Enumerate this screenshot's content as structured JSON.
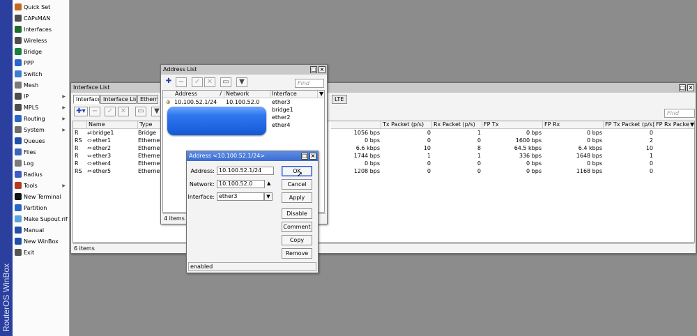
{
  "app": {
    "brand": "RouterOS WinBox"
  },
  "menu": {
    "items": [
      {
        "label": "Quick Set",
        "icon": "quick-set-icon",
        "color": "#c06b1b"
      },
      {
        "label": "CAPsMAN",
        "icon": "capsman-icon",
        "color": "#4d4d4d"
      },
      {
        "label": "Interfaces",
        "icon": "interfaces-icon",
        "color": "#1f6b2f"
      },
      {
        "label": "Wireless",
        "icon": "wireless-icon",
        "color": "#4d4d4d"
      },
      {
        "label": "Bridge",
        "icon": "bridge-icon",
        "color": "#1a7f3f"
      },
      {
        "label": "PPP",
        "icon": "ppp-icon",
        "color": "#2a66c8"
      },
      {
        "label": "Switch",
        "icon": "switch-icon",
        "color": "#3b7fd4"
      },
      {
        "label": "Mesh",
        "icon": "mesh-icon",
        "color": "#7a7a7a"
      },
      {
        "label": "IP",
        "icon": "ip-icon",
        "color": "#4d4d4d",
        "arrow": "▶"
      },
      {
        "label": "MPLS",
        "icon": "mpls-icon",
        "color": "#4d4d4d",
        "arrow": "▶"
      },
      {
        "label": "Routing",
        "icon": "routing-icon",
        "color": "#2a66c8",
        "arrow": "▶"
      },
      {
        "label": "System",
        "icon": "system-icon",
        "color": "#6d6d6d",
        "arrow": "▶"
      },
      {
        "label": "Queues",
        "icon": "queues-icon",
        "color": "#1f4fa7"
      },
      {
        "label": "Files",
        "icon": "files-icon",
        "color": "#3a66b8"
      },
      {
        "label": "Log",
        "icon": "log-icon",
        "color": "#7a7a7a"
      },
      {
        "label": "Radius",
        "icon": "radius-icon",
        "color": "#3b5cc8"
      },
      {
        "label": "Tools",
        "icon": "tools-icon",
        "color": "#b33a1f",
        "arrow": "▶"
      },
      {
        "label": "New Terminal",
        "icon": "terminal-icon",
        "color": "#111111"
      },
      {
        "label": "Partition",
        "icon": "partition-icon",
        "color": "#2a66c8"
      },
      {
        "label": "Make Supout.rif",
        "icon": "supout-icon",
        "color": "#5aa3d8"
      },
      {
        "label": "Manual",
        "icon": "manual-icon",
        "color": "#1f4fa7"
      },
      {
        "label": "New WinBox",
        "icon": "new-winbox-icon",
        "color": "#1f4fa7"
      },
      {
        "label": "Exit",
        "icon": "exit-icon",
        "color": "#555555"
      }
    ]
  },
  "interface_list": {
    "title": "Interface List",
    "tabs": [
      "Interface",
      "Interface List",
      "Ethernet",
      "LTE"
    ],
    "find_placeholder": "Find",
    "left_columns": [
      "Name",
      "Type"
    ],
    "right_columns": [
      "Tx Packet (p/s)",
      "Rx Packet (p/s)",
      "FP Tx",
      "FP Rx",
      "FP Tx Packet (p/s)",
      "FP Rx Packe"
    ],
    "rows": [
      {
        "flag": "R",
        "name": "bridge1",
        "type": "Bridge",
        "rx": "1056 bps",
        "tx_packet": "0",
        "rx_packet": "1",
        "fp_tx": "0 bps",
        "fp_rx": "0 bps",
        "fp_tx_packet": "0"
      },
      {
        "flag": "RS",
        "name": "ether1",
        "type": "Ethernet",
        "rx": "0 bps",
        "tx_packet": "0",
        "rx_packet": "0",
        "fp_tx": "1600 bps",
        "fp_rx": "0 bps",
        "fp_tx_packet": "2"
      },
      {
        "flag": "R",
        "name": "ether2",
        "type": "Ethernet",
        "rx": "6.6 kbps",
        "tx_packet": "10",
        "rx_packet": "8",
        "fp_tx": "64.5 kbps",
        "fp_rx": "6.4 kbps",
        "fp_tx_packet": "10"
      },
      {
        "flag": "R",
        "name": "ether3",
        "type": "Ethernet",
        "rx": "1744 bps",
        "tx_packet": "1",
        "rx_packet": "1",
        "fp_tx": "336 bps",
        "fp_rx": "1648 bps",
        "fp_tx_packet": "1"
      },
      {
        "flag": "R",
        "name": "ether4",
        "type": "Ethernet",
        "rx": "0 bps",
        "tx_packet": "0",
        "rx_packet": "0",
        "fp_tx": "0 bps",
        "fp_rx": "0 bps",
        "fp_tx_packet": "0"
      },
      {
        "flag": "RS",
        "name": "ether5",
        "type": "Ethernet",
        "rx": "1208 bps",
        "tx_packet": "0",
        "rx_packet": "0",
        "fp_tx": "0 bps",
        "fp_rx": "1168 bps",
        "fp_tx_packet": "0"
      }
    ],
    "status": "6 items"
  },
  "address_list": {
    "title": "Address List",
    "find_placeholder": "Find",
    "columns": [
      "Address",
      "Network",
      "Interface"
    ],
    "rows": [
      {
        "address": "10.100.52.1/24",
        "network": "10.100.52.0",
        "interface": "ether3"
      },
      {
        "address": "",
        "network": "",
        "interface": "bridge1"
      },
      {
        "address": "",
        "network": "",
        "interface": "ether2"
      },
      {
        "address": "",
        "network": "",
        "interface": "ether4"
      }
    ],
    "status": "4 items"
  },
  "address_dialog": {
    "title": "Address <10.100.52.1/24>",
    "address_label": "Address:",
    "address_value": "10.100.52.1/24",
    "network_label": "Network:",
    "network_value": "10.100.52.0",
    "interface_label": "Interface:",
    "interface_value": "ether3",
    "buttons": {
      "ok": "OK",
      "cancel": "Cancel",
      "apply": "Apply",
      "disable": "Disable",
      "comment": "Comment",
      "copy": "Copy",
      "remove": "Remove"
    },
    "status": "enabled"
  },
  "colors": {
    "left_strip": "#2a3f9e",
    "titlebar_active": "#4a78d6",
    "titlebar_inactive": "#c9c9c9",
    "desktop": "#8c8c8c",
    "highlight": "#1f66e0"
  }
}
